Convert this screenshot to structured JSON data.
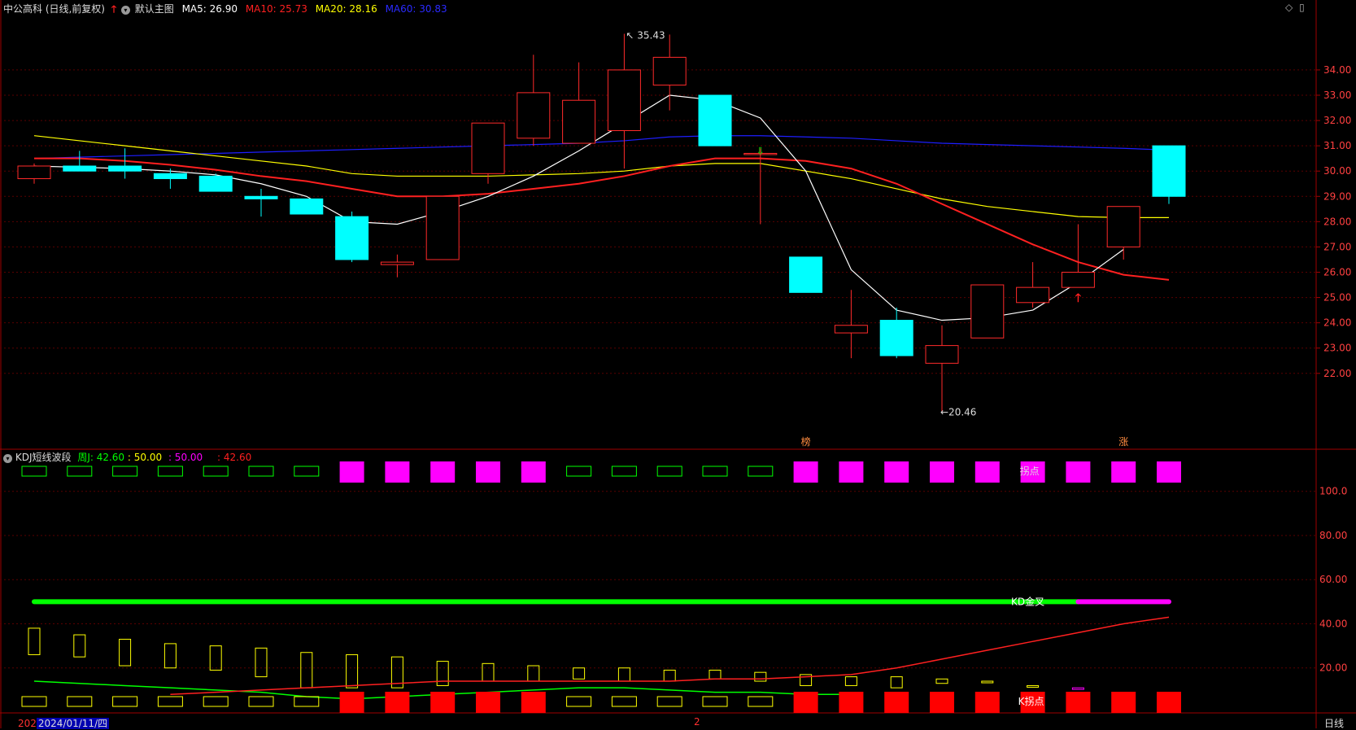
{
  "header": {
    "stock_title": "中公高科 (日线,前复权)",
    "main_chart_label": "默认主图",
    "ma_items": [
      {
        "label": "MA5: 26.90",
        "color": "#ffffff"
      },
      {
        "label": "MA10: 25.73",
        "color": "#ff2020"
      },
      {
        "label": "MA20: 28.16",
        "color": "#ffff00"
      },
      {
        "label": "MA60: 30.83",
        "color": "#1e1eff"
      }
    ]
  },
  "sub_header": {
    "indicator_name": "KDJ短线波段",
    "items": [
      {
        "label": "周J: 42.60",
        "color": "#00ff00"
      },
      {
        "label": ": 50.00",
        "color": "#ffff00"
      },
      {
        "label": ": 50.00",
        "color": "#ff00ff"
      },
      {
        "label": ": 42.60",
        "color": "#ff2020"
      }
    ]
  },
  "colors": {
    "up": "#ff2a2a",
    "down": "#00ffff",
    "ma5": "#ffffff",
    "ma10": "#ff2020",
    "ma20": "#ffff00",
    "ma60": "#1e1eff",
    "grid": "#5a0000",
    "axis_text": "#ff4040",
    "magenta": "#ff00ff",
    "green": "#00ff00",
    "yellow": "#ffff00"
  },
  "chart_data": {
    "type": "candlestick",
    "price_axis": {
      "min": 19.0,
      "max": 35.8,
      "ticks": [
        "34.00",
        "33.00",
        "32.00",
        "31.00",
        "30.00",
        "29.00",
        "28.00",
        "27.00",
        "26.00",
        "25.00",
        "24.00",
        "23.00",
        "22.00"
      ]
    },
    "candles": [
      {
        "o": 29.7,
        "c": 30.2,
        "h": 30.3,
        "l": 29.5
      },
      {
        "o": 30.2,
        "c": 30.0,
        "h": 30.8,
        "l": 30.0
      },
      {
        "o": 30.2,
        "c": 30.0,
        "h": 30.9,
        "l": 29.7
      },
      {
        "o": 29.9,
        "c": 29.7,
        "h": 30.1,
        "l": 29.3
      },
      {
        "o": 29.8,
        "c": 29.2,
        "h": 29.9,
        "l": 29.2
      },
      {
        "o": 29.0,
        "c": 28.9,
        "h": 29.3,
        "l": 28.2
      },
      {
        "o": 28.9,
        "c": 28.3,
        "h": 28.9,
        "l": 28.3
      },
      {
        "o": 28.2,
        "c": 26.5,
        "h": 28.4,
        "l": 26.4
      },
      {
        "o": 26.3,
        "c": 26.4,
        "h": 26.7,
        "l": 25.8
      },
      {
        "o": 26.5,
        "c": 29.0,
        "h": 29.0,
        "l": 26.5
      },
      {
        "o": 29.9,
        "c": 31.9,
        "h": 31.9,
        "l": 29.5
      },
      {
        "o": 31.3,
        "c": 33.1,
        "h": 34.6,
        "l": 31.0
      },
      {
        "o": 31.1,
        "c": 32.8,
        "h": 34.3,
        "l": 31.1
      },
      {
        "o": 31.6,
        "c": 34.0,
        "h": 35.43,
        "l": 30.1
      },
      {
        "o": 33.4,
        "c": 34.5,
        "h": 35.4,
        "l": 32.4
      },
      {
        "o": 33.0,
        "c": 31.0,
        "h": 33.0,
        "l": 31.0
      },
      {
        "o": 30.7,
        "c": 30.7,
        "h": 30.9,
        "l": 27.9
      },
      {
        "o": 26.6,
        "c": 25.2,
        "h": 26.6,
        "l": 25.2
      },
      {
        "o": 23.6,
        "c": 23.9,
        "h": 25.3,
        "l": 22.6
      },
      {
        "o": 24.1,
        "c": 22.7,
        "h": 24.6,
        "l": 22.6
      },
      {
        "o": 22.4,
        "c": 23.1,
        "h": 23.9,
        "l": 20.46
      },
      {
        "o": 23.4,
        "c": 25.5,
        "h": 25.5,
        "l": 23.4
      },
      {
        "o": 24.8,
        "c": 25.4,
        "h": 26.4,
        "l": 24.6
      },
      {
        "o": 25.4,
        "c": 26.0,
        "h": 27.9,
        "l": 25.4
      },
      {
        "o": 27.0,
        "c": 28.6,
        "h": 28.6,
        "l": 26.5
      },
      {
        "o": 31.0,
        "c": 29.0,
        "h": 31.0,
        "l": 28.7
      }
    ],
    "ma5": [
      30.2,
      30.15,
      30.1,
      30.0,
      29.85,
      29.5,
      29.0,
      28.0,
      27.9,
      28.4,
      29.0,
      29.8,
      30.8,
      31.9,
      33.0,
      32.8,
      32.1,
      30.0,
      26.1,
      24.5,
      24.1,
      24.2,
      24.5,
      25.6,
      26.9
    ],
    "ma10": [
      30.5,
      30.5,
      30.4,
      30.25,
      30.05,
      29.8,
      29.6,
      29.3,
      29.0,
      29.0,
      29.1,
      29.3,
      29.5,
      29.8,
      30.2,
      30.5,
      30.5,
      30.4,
      30.1,
      29.5,
      28.7,
      27.9,
      27.1,
      26.4,
      25.9,
      25.7
    ],
    "ma20": [
      31.4,
      31.2,
      31.0,
      30.8,
      30.6,
      30.4,
      30.2,
      29.9,
      29.8,
      29.8,
      29.8,
      29.85,
      29.9,
      30.0,
      30.2,
      30.3,
      30.3,
      30.0,
      29.7,
      29.3,
      28.9,
      28.6,
      28.4,
      28.2,
      28.16,
      28.16
    ],
    "ma60": [
      30.5,
      30.55,
      30.6,
      30.65,
      30.7,
      30.75,
      30.8,
      30.85,
      30.9,
      30.95,
      31.0,
      31.05,
      31.1,
      31.2,
      31.35,
      31.4,
      31.4,
      31.35,
      31.3,
      31.2,
      31.1,
      31.05,
      31.0,
      30.95,
      30.9,
      30.83
    ],
    "annotations": {
      "high_label": "35.43",
      "low_label": "←20.46"
    },
    "markers": [
      "榜",
      "涨"
    ],
    "kdj_axis": {
      "min": 0,
      "max": 115,
      "ticks": [
        "100.0",
        "80.00",
        "60.00",
        "40.00",
        "20.00"
      ]
    },
    "kdj_top_boxes": [
      "g",
      "g",
      "g",
      "g",
      "g",
      "g",
      "g",
      "m",
      "m",
      "m",
      "m",
      "m",
      "g",
      "g",
      "g",
      "g",
      "g",
      "m",
      "m",
      "m",
      "m",
      "m",
      "m",
      "m",
      "m",
      "m"
    ],
    "kdj_bottom_boxes": [
      "y",
      "y",
      "y",
      "y",
      "y",
      "y",
      "y",
      "r",
      "r",
      "r",
      "r",
      "r",
      "y",
      "y",
      "y",
      "y",
      "y",
      "r",
      "r",
      "r",
      "r",
      "r",
      "r",
      "r",
      "r",
      "r"
    ],
    "kdj_bars_top": [
      38,
      35,
      33,
      31,
      30,
      29,
      27,
      26,
      25,
      23,
      22,
      21,
      20,
      20,
      19,
      19,
      18,
      17,
      16,
      16,
      15,
      14,
      12,
      11,
      9,
      8
    ],
    "kdj_bars_bottom": [
      26,
      25,
      21,
      20,
      19,
      16,
      11,
      11,
      11,
      12,
      14,
      14,
      15,
      14,
      14,
      15,
      14,
      12,
      12,
      11,
      13,
      20,
      22,
      23,
      25,
      22
    ],
    "kdj_bar_colors": [
      "y",
      "y",
      "y",
      "y",
      "y",
      "y",
      "y",
      "y",
      "y",
      "y",
      "y",
      "y",
      "y",
      "y",
      "y",
      "y",
      "y",
      "y",
      "y",
      "y",
      "y",
      "y",
      "y",
      "m",
      "m",
      "m"
    ],
    "kdj_green_line": [
      14,
      13,
      12,
      11,
      10,
      9,
      7,
      6,
      7,
      8,
      9,
      10,
      11,
      11,
      10,
      9,
      9,
      8,
      8
    ],
    "kdj_red_line": [
      8,
      9,
      10,
      11,
      12,
      13,
      14,
      14,
      14,
      14,
      14,
      14,
      15,
      15,
      16,
      17,
      20,
      24,
      28,
      32,
      36,
      40,
      43
    ],
    "kd_bar_value": 50,
    "kd_label": "KD金叉",
    "turning_label_top": "拐点",
    "turning_label_bottom": "K拐点"
  },
  "time_axis": {
    "left_label": "202",
    "date_label": "2024/01/11/四",
    "mid_label": "2",
    "period_label": "日线"
  }
}
